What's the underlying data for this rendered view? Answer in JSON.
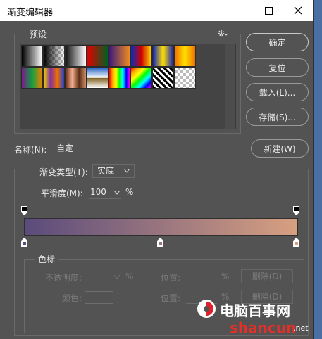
{
  "window": {
    "title": "渐变编辑器"
  },
  "presets": {
    "label": "预设",
    "swatches": [
      {
        "name": "foreground-to-background",
        "bg": "linear-gradient(to right,#000,#fff)"
      },
      {
        "name": "foreground-to-transparent",
        "bg": "linear-gradient(to right,#000,rgba(0,0,0,0)),repeating-conic-gradient(#bbb 0 25%,#fff 0 50%) 0 0/8px 8px"
      },
      {
        "name": "black-white",
        "bg": "linear-gradient(to right,#111,#fff)"
      },
      {
        "name": "red-green",
        "bg": "linear-gradient(to right,#e00000,#006020)"
      },
      {
        "name": "violet-orange",
        "bg": "linear-gradient(to right,#3a1a7a,#f08a20)"
      },
      {
        "name": "blue-red-yellow",
        "bg": "linear-gradient(to right,#0030c0,#d00000,#ffe000)"
      },
      {
        "name": "blue-yellow-blue",
        "bg": "linear-gradient(to right,#1020c0,#ffe000,#1020c0)"
      },
      {
        "name": "orange-yellow-orange",
        "bg": "linear-gradient(to right,#f07000,#ffe000,#f07000)"
      },
      {
        "name": "violet-green-orange",
        "bg": "linear-gradient(to right,#7a1a8a,#10a040,#f08000)"
      },
      {
        "name": "yellow-violet-orange-blue",
        "bg": "linear-gradient(to right,#f0d000,#8030a0,#f07000,#2040d0)"
      },
      {
        "name": "copper",
        "bg": "linear-gradient(to right,#6a2a10,#f0b090,#5a2a10,#d09070)"
      },
      {
        "name": "chrome",
        "bg": "linear-gradient(to bottom,#2060c0,#fff 50%,#806020 52%,#fff)"
      },
      {
        "name": "spectrum",
        "bg": "linear-gradient(to right,red,orange,yellow,lime,cyan,blue,magenta)"
      },
      {
        "name": "transparent-rainbow",
        "bg": "linear-gradient(135deg,red,orange,yellow,lime,cyan,blue,magenta)"
      },
      {
        "name": "transparent-stripes",
        "bg": "repeating-linear-gradient(45deg,#000 0 3px,#fff 3px 6px)"
      },
      {
        "name": "neutral-density",
        "bg": "repeating-conic-gradient(#bbb 0 25%,#fff 0 50%) 0 0/8px 8px"
      }
    ]
  },
  "buttons": {
    "ok": "确定",
    "reset": "复位",
    "load": "载入(L)...",
    "save": "存储(S)...",
    "new": "新建(W)"
  },
  "name": {
    "label": "名称(N):",
    "value": "自定"
  },
  "gradient_type": {
    "label": "渐变类型(T):",
    "value": "实底"
  },
  "smoothness": {
    "label": "平滑度(M):",
    "value": "100",
    "unit": "%"
  },
  "stops": {
    "label": "色标",
    "opacity_label": "不透明度:",
    "opacity_unit": "%",
    "location_label": "位置:",
    "location_unit": "%",
    "delete_label": "删除(D)",
    "color_label": "颜色:",
    "color_location_label": "位置:",
    "color_location_unit": "%",
    "color_delete_label": "删除(D)"
  },
  "gradient": {
    "start_color": "#5a4b7c",
    "end_color": "#d8a081",
    "color_stop_locations_pct": [
      0,
      50,
      100
    ],
    "opacity_stop_locations_pct": [
      0,
      100
    ]
  },
  "watermark": {
    "text_top": "电脑百事网",
    "text_bottom": "shancun",
    "text_tail": ".net"
  }
}
